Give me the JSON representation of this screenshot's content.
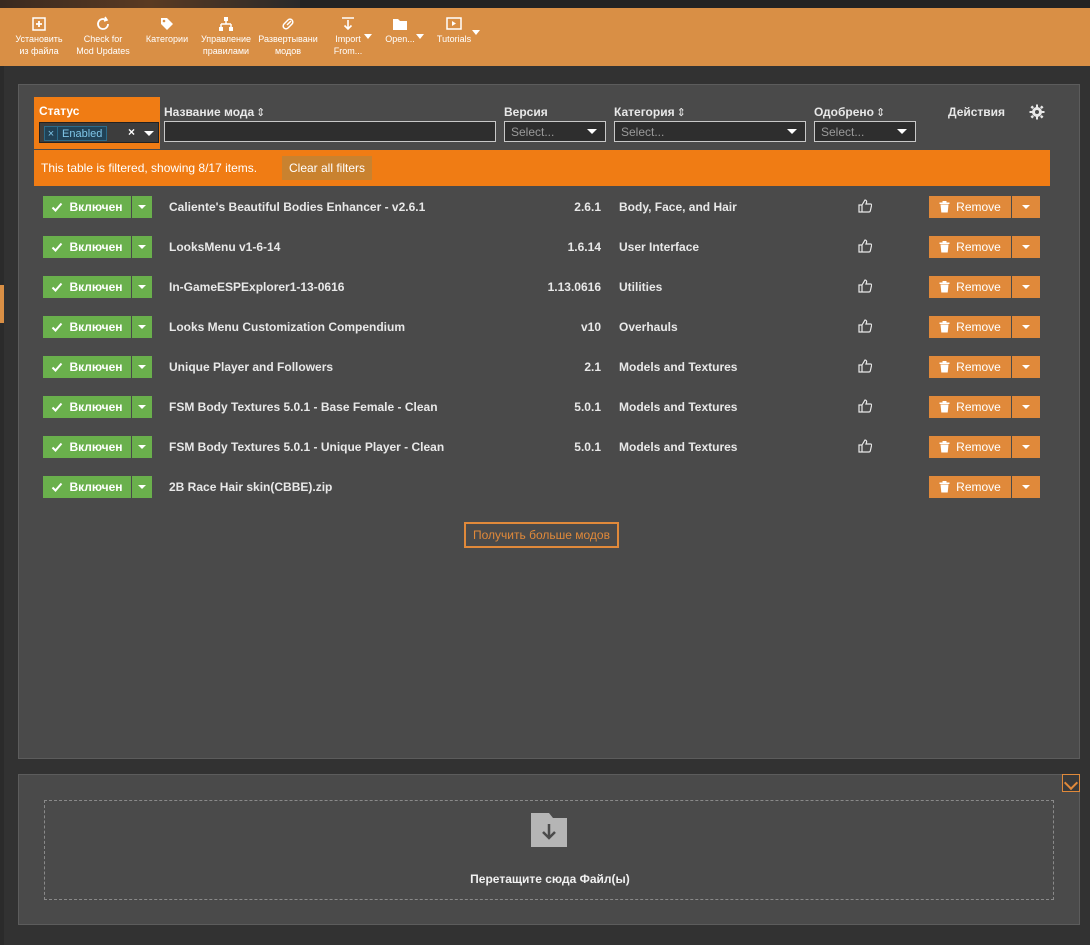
{
  "toolbar": {
    "items": [
      {
        "line1": "Установить",
        "line2": "из файла",
        "icon": "plus-icon"
      },
      {
        "line1": "Check for",
        "line2": "Mod Updates",
        "icon": "refresh-icon"
      },
      {
        "line1": "Категории",
        "line2": "",
        "icon": "tag-icon"
      },
      {
        "line1": "Управление",
        "line2": "правилами",
        "icon": "hierarchy-icon"
      },
      {
        "line1": "Развертывани",
        "line2": "модов",
        "icon": "link-icon"
      },
      {
        "line1": "Import",
        "line2": "From...",
        "icon": "import-icon"
      },
      {
        "line1": "Open...",
        "line2": "",
        "icon": "folder-icon"
      },
      {
        "line1": "Tutorials",
        "line2": "",
        "icon": "video-icon"
      }
    ]
  },
  "table": {
    "headers": {
      "status": "Статус",
      "name": "Название мода",
      "version": "Версия",
      "category": "Категория",
      "endorsed": "Одобрено",
      "actions": "Действия"
    },
    "sort_glyph": "⇕",
    "status_filter_tag": "Enabled",
    "status_filter_remove": "×",
    "status_filter_clear": "×",
    "select_placeholder": "Select...",
    "filter_notice": "This table is filtered, showing 8/17 items.",
    "clear_filters": "Clear all filters",
    "enabled_label": "Включен",
    "remove_label": "Remove",
    "rows": [
      {
        "name": "Caliente's Beautiful Bodies Enhancer - v2.6.1",
        "version": "2.6.1",
        "category": "Body, Face, and Hair",
        "endorse": true
      },
      {
        "name": "LooksMenu v1-6-14",
        "version": "1.6.14",
        "category": "User Interface",
        "endorse": true
      },
      {
        "name": "In-GameESPExplorer1-13-0616",
        "version": "1.13.0616",
        "category": "Utilities",
        "endorse": true
      },
      {
        "name": "Looks Menu Customization Compendium",
        "version": "v10",
        "category": "Overhauls",
        "endorse": true
      },
      {
        "name": "Unique Player and Followers",
        "version": "2.1",
        "category": "Models and Textures",
        "endorse": true
      },
      {
        "name": "FSM Body Textures 5.0.1 - Base Female - Clean",
        "version": "5.0.1",
        "category": "Models and Textures",
        "endorse": true
      },
      {
        "name": "FSM Body Textures 5.0.1 - Unique Player - Clean",
        "version": "5.0.1",
        "category": "Models and Textures",
        "endorse": true
      },
      {
        "name": "2B Race Hair skin(CBBE).zip",
        "version": "",
        "category": "",
        "endorse": false
      }
    ],
    "get_more": "Получить больше модов"
  },
  "dropzone": {
    "text": "Перетащите сюда Файл(ы)"
  },
  "colors": {
    "toolbar": "#d98f45",
    "filter_orange": "#f07c14",
    "enabled_green": "#6ab04c",
    "remove_orange": "#e0893a",
    "panel": "#4a4a4a"
  }
}
